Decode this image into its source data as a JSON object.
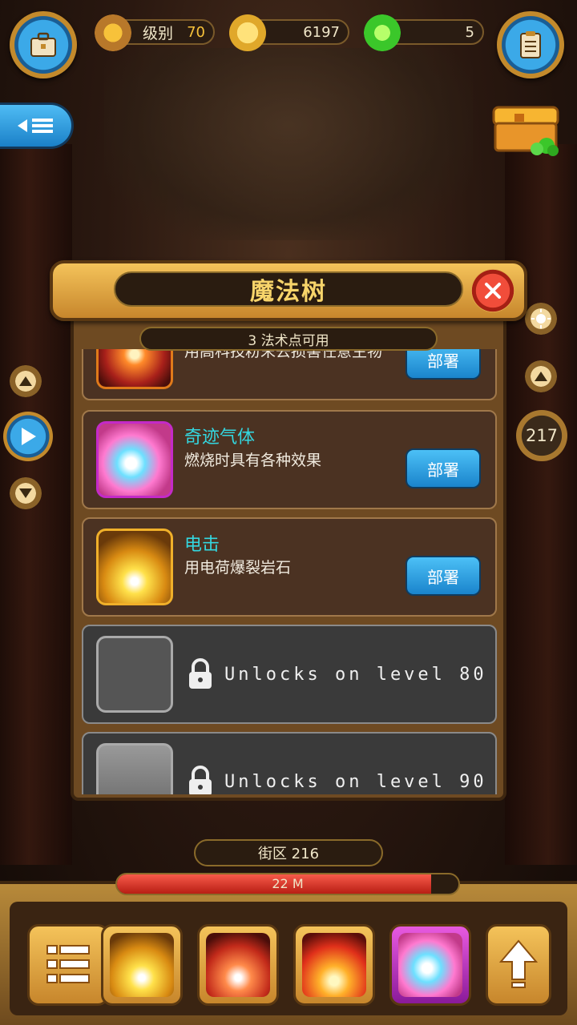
{
  "top_bar": {
    "level_label": "级别",
    "level_value": "70",
    "coins": "6197",
    "gems": "5"
  },
  "panel": {
    "title": "魔法树",
    "spell_points": "3 法术点可用",
    "cards": [
      {
        "name": "",
        "desc": "用高科技粉末去损害任意生物",
        "button": "部署",
        "locked": false
      },
      {
        "name": "奇迹气体",
        "desc": "燃烧时具有各种效果",
        "button": "部署",
        "locked": false
      },
      {
        "name": "电击",
        "desc": "用电荷爆裂岩石",
        "button": "部署",
        "locked": false
      },
      {
        "locked_text": "Unlocks on level 80",
        "locked": true
      },
      {
        "locked_text": "Unlocks on level 90",
        "locked": true
      }
    ]
  },
  "side": {
    "depth_value": "217"
  },
  "bottom": {
    "district_label": "街区 216",
    "progress_text": "22 M",
    "progress_fraction": 0.92
  },
  "colors": {
    "accent_blue": "#3ba9e8",
    "gold": "#f4c35a",
    "skill_name": "#33d7e0",
    "level_value": "#f7c23a",
    "progress_red": "#f75a4a"
  }
}
